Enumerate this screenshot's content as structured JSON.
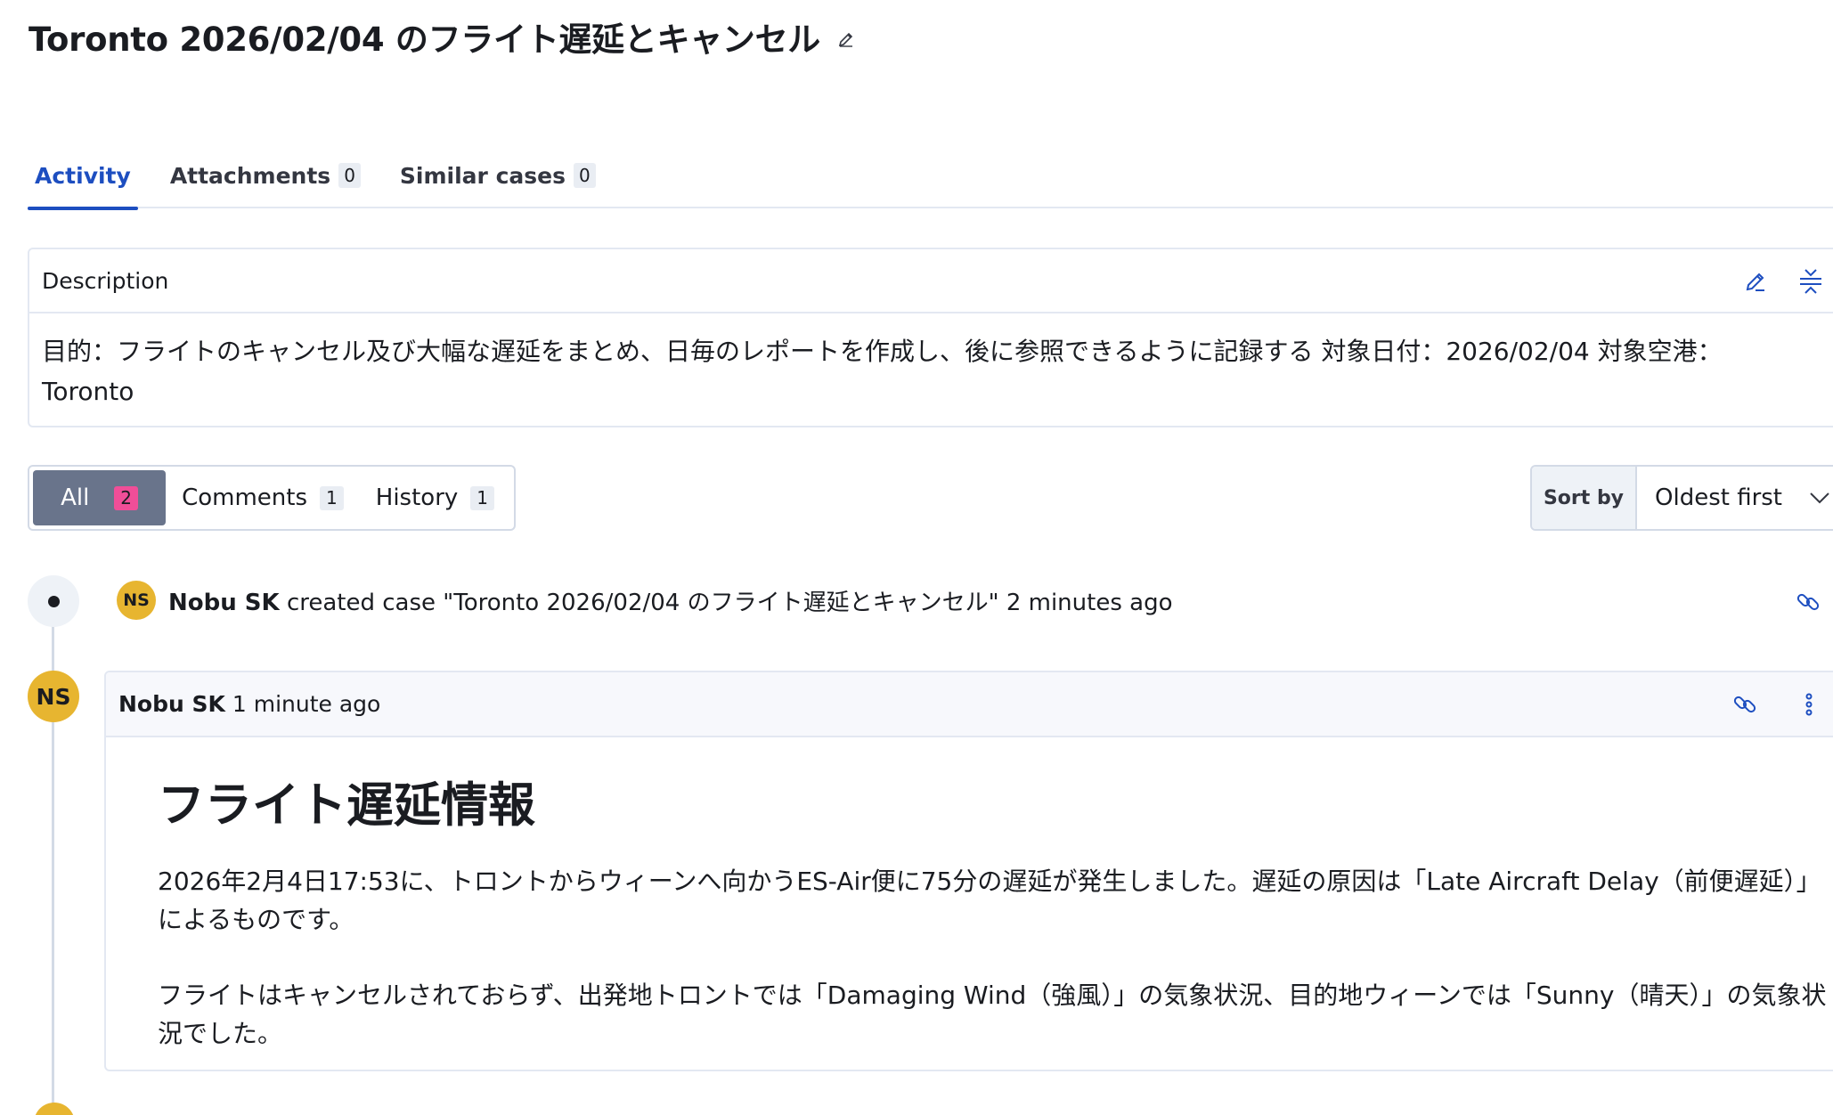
{
  "case": {
    "title": "Toronto 2026/02/04 のフライト遅延とキャンセル"
  },
  "tabs": [
    {
      "label": "Activity",
      "count": ""
    },
    {
      "label": "Attachments",
      "count": "0"
    },
    {
      "label": "Similar cases",
      "count": "0"
    }
  ],
  "description": {
    "label": "Description",
    "text": "目的：フライトのキャンセル及び大幅な遅延をまとめ、日毎のレポートを作成し、後に参照できるように記録する 対象日付：2026/02/04 対象空港：Toronto"
  },
  "filters": [
    {
      "label": "All",
      "count": "2"
    },
    {
      "label": "Comments",
      "count": "1"
    },
    {
      "label": "History",
      "count": "1"
    }
  ],
  "sort": {
    "label": "Sort by",
    "value": "Oldest first"
  },
  "activity": {
    "event": {
      "avatar": "NS",
      "user": "Nobu SK",
      "text": "created case \"Toronto 2026/02/04 のフライト遅延とキャンセル\"",
      "time": "2 minutes ago"
    },
    "comment": {
      "avatar": "NS",
      "user": "Nobu SK",
      "time": "1 minute ago",
      "heading": "フライト遅延情報",
      "paragraphs": [
        "2026年2月4日17:53に、トロントからウィーンへ向かうES-Air便に75分の遅延が発生しました。遅延の原因は「Late Aircraft Delay（前便遅延）」によるものです。",
        "フライトはキャンセルされておらず、出発地トロントでは「Damaging Wind（強風）」の気象状況、目的地ウィーンでは「Sunny（晴天）」の気象状況でした。"
      ]
    }
  },
  "colors": {
    "accent": "#1d4ec0",
    "avatar": "#e7b530",
    "filter_selected": "#69748b",
    "badge_pink": "#f04e98"
  }
}
